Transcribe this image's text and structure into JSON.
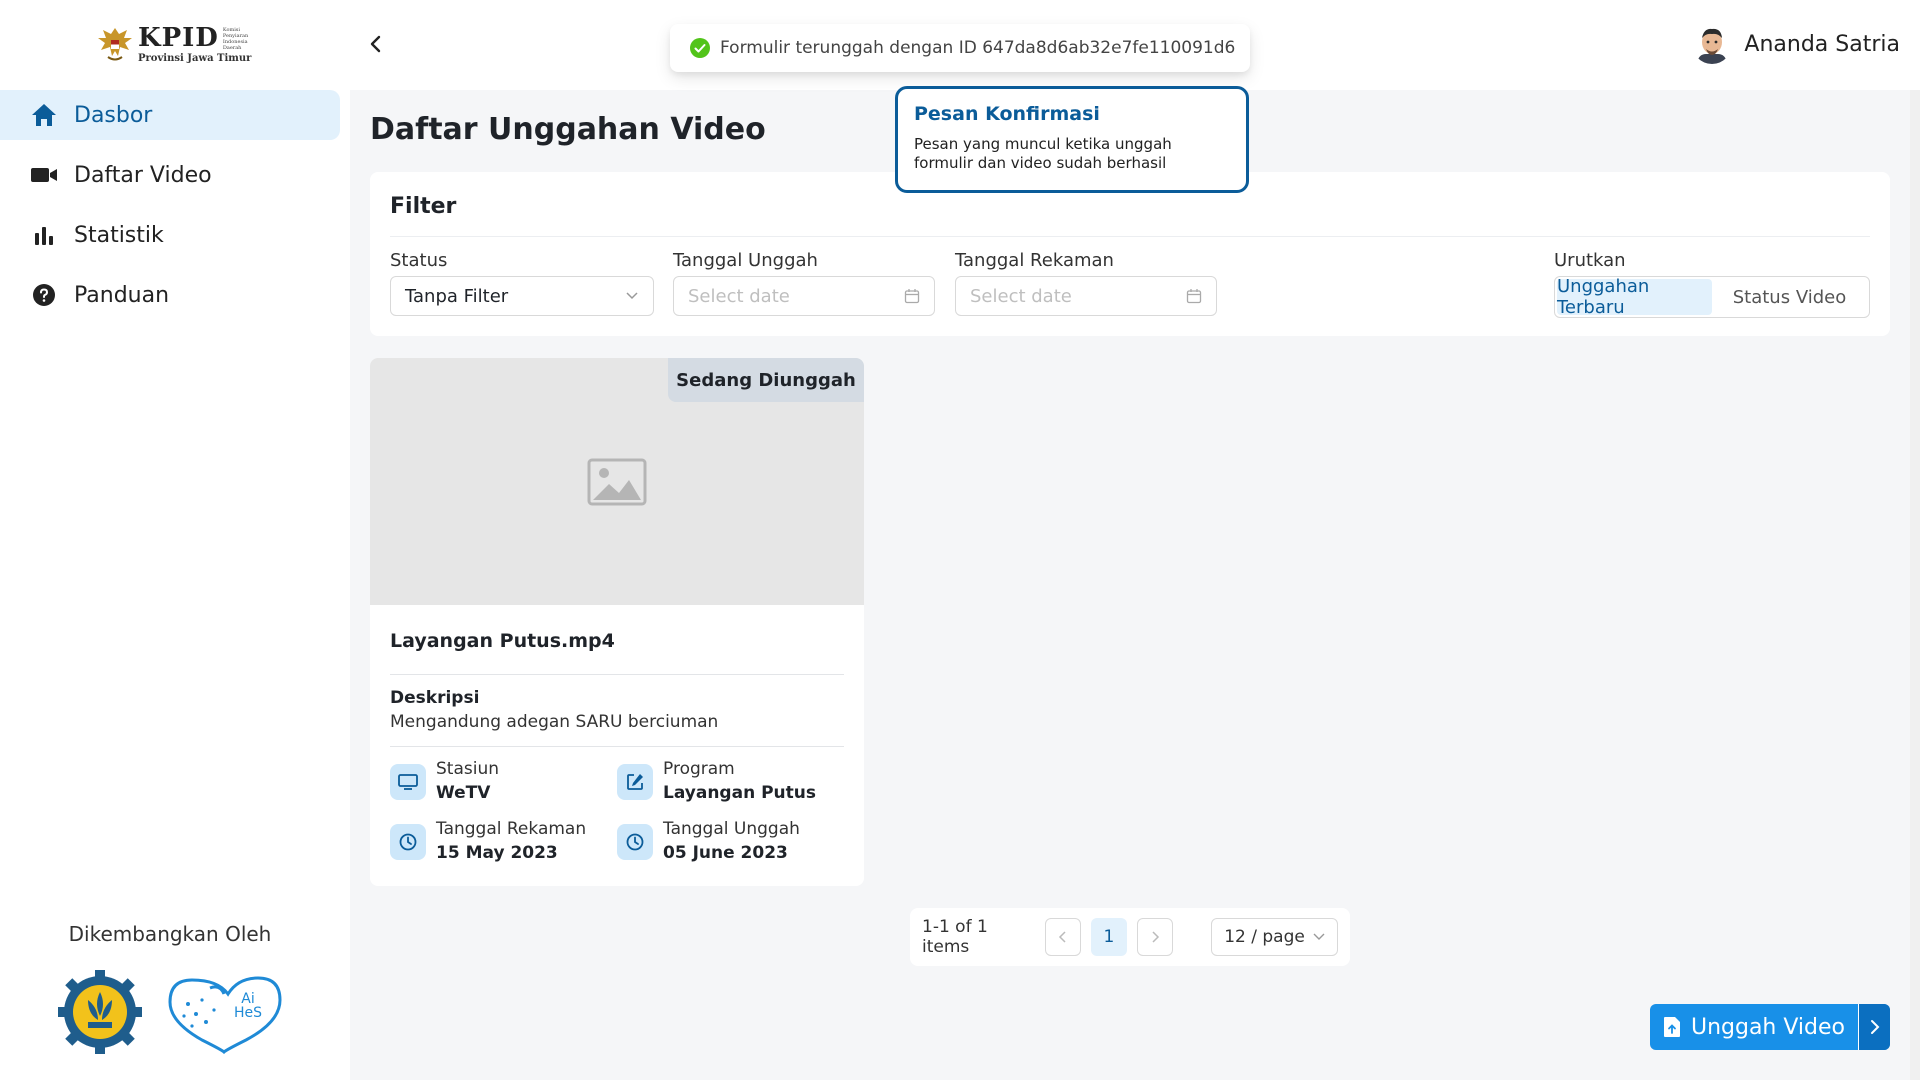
{
  "header": {
    "logo": {
      "main": "KPID",
      "tiny": "Komisi Penyiaran Indonesia Daerah",
      "sub": "Provinsi Jawa Timur"
    },
    "user_name": "Ananda Satria"
  },
  "toast": {
    "message": "Formulir terunggah dengan ID 647da8d6ab32e7fe110091d6"
  },
  "callout": {
    "title": "Pesan Konfirmasi",
    "body": "Pesan yang muncul ketika unggah formulir dan video sudah berhasil"
  },
  "sidebar": {
    "items": [
      {
        "label": "Dasbor",
        "icon": "home-icon",
        "active": true
      },
      {
        "label": "Daftar Video",
        "icon": "video-camera-icon",
        "active": false
      },
      {
        "label": "Statistik",
        "icon": "bar-chart-icon",
        "active": false
      },
      {
        "label": "Panduan",
        "icon": "help-circle-icon",
        "active": false
      }
    ],
    "developed_by": "Dikembangkan Oleh",
    "partner_logo_text": "Ai HeS"
  },
  "main": {
    "title": "Daftar Unggahan Video",
    "filter": {
      "title": "Filter",
      "status_label": "Status",
      "status_value": "Tanpa Filter",
      "upload_date_label": "Tanggal Unggah",
      "upload_date_placeholder": "Select date",
      "record_date_label": "Tanggal Rekaman",
      "record_date_placeholder": "Select date",
      "sort_label": "Urutkan",
      "sort_options": [
        "Unggahan Terbaru",
        "Status Video"
      ],
      "sort_selected": "Unggahan Terbaru"
    },
    "videos": [
      {
        "badge": "Sedang Diunggah",
        "title": "Layangan Putus.mp4",
        "desc_label": "Deskripsi",
        "desc": "Mengandung adegan SARU berciuman",
        "station_label": "Stasiun",
        "station": "WeTV",
        "program_label": "Program",
        "program": "Layangan Putus",
        "record_date_label": "Tanggal Rekaman",
        "record_date": "15 May 2023",
        "upload_date_label": "Tanggal Unggah",
        "upload_date": "05 June 2023"
      }
    ],
    "pagination": {
      "summary": "1-1 of 1 items",
      "current_page": "1",
      "page_size": "12 / page"
    },
    "upload_button": "Unggah Video"
  },
  "colors": {
    "primary": "#1890e8",
    "accent_dark": "#0b5c99",
    "active_bg": "#e2f1fc",
    "success": "#52c41a"
  }
}
